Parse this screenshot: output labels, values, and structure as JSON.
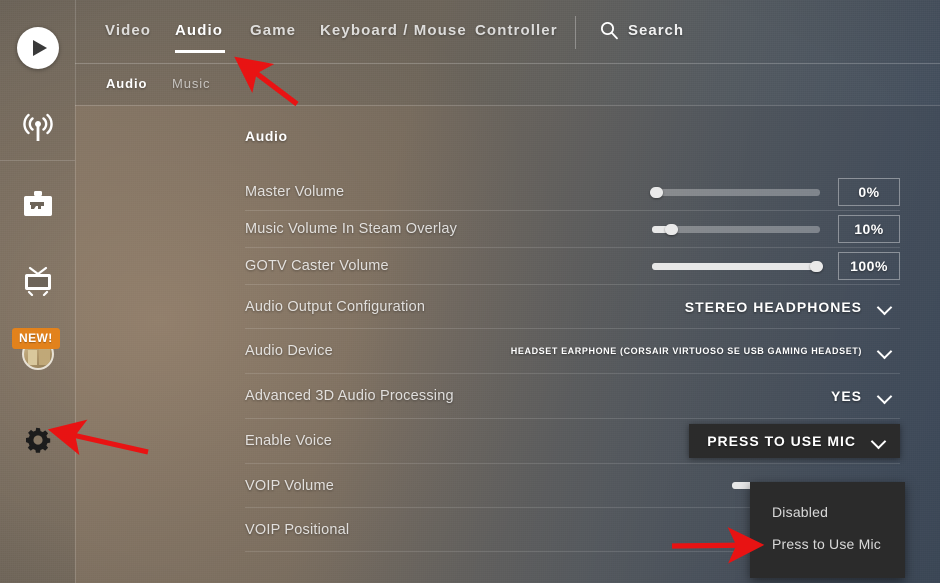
{
  "sidebar": {
    "items": [
      {
        "name": "play",
        "icon": "play-icon",
        "label": "Play"
      },
      {
        "name": "broadcast",
        "icon": "broadcast-antenna-icon",
        "label": "Watch Broadcast"
      },
      {
        "name": "inventory",
        "icon": "weapon-case-icon",
        "label": "Inventory"
      },
      {
        "name": "watch",
        "icon": "tv-icon",
        "label": "Watch"
      },
      {
        "name": "profile",
        "icon": "avatar-icon",
        "label": "Profile"
      },
      {
        "name": "settings",
        "icon": "gear-icon",
        "label": "Settings"
      }
    ],
    "badge": "NEW!",
    "badge_color": "#e2821c"
  },
  "header": {
    "tabs": [
      {
        "label": "Video",
        "active": false
      },
      {
        "label": "Audio",
        "active": true
      },
      {
        "label": "Game",
        "active": false
      },
      {
        "label": "Keyboard / Mouse",
        "active": false
      },
      {
        "label": "Controller",
        "active": false
      }
    ],
    "search": {
      "label": "Search",
      "icon": "search-icon"
    },
    "subtabs": [
      {
        "label": "Audio",
        "active": true
      },
      {
        "label": "Music",
        "active": false
      }
    ]
  },
  "main": {
    "section_title": "Audio",
    "rows": [
      {
        "label": "Master Volume",
        "type": "slider",
        "value": "0%",
        "percent": 0
      },
      {
        "label": "Music Volume In Steam Overlay",
        "type": "slider",
        "value": "10%",
        "percent": 10
      },
      {
        "label": "GOTV Caster Volume",
        "type": "slider",
        "value": "100%",
        "percent": 100
      },
      {
        "label": "Audio Output Configuration",
        "type": "dropdown",
        "value": "STEREO HEADPHONES"
      },
      {
        "label": "Audio Device",
        "type": "dropdown-small",
        "value": "HEADSET EARPHONE (CORSAIR VIRTUOSO SE USB GAMING HEADSET)"
      },
      {
        "label": "Advanced 3D Audio Processing",
        "type": "dropdown",
        "value": "YES"
      },
      {
        "label": "Enable Voice",
        "type": "dropdown-open",
        "value": "PRESS TO USE MIC"
      },
      {
        "label": "VOIP Volume",
        "type": "slider-partial",
        "value": "",
        "percent": 30
      },
      {
        "label": "VOIP Positional",
        "type": "hidden-control",
        "value": ""
      }
    ],
    "dropdown_menu": {
      "options": [
        {
          "label": "Disabled",
          "selected": false
        },
        {
          "label": "Press to Use Mic",
          "selected": true
        }
      ]
    }
  },
  "annotations": {
    "arrow_color": "#e81313",
    "arrows": [
      {
        "name": "arrow-to-audio-tab",
        "points_to": "Audio tab underline"
      },
      {
        "name": "arrow-to-settings-gear",
        "points_to": "Settings gear icon"
      },
      {
        "name": "arrow-to-press-to-use-mic",
        "points_to": "Press to Use Mic option"
      }
    ]
  }
}
